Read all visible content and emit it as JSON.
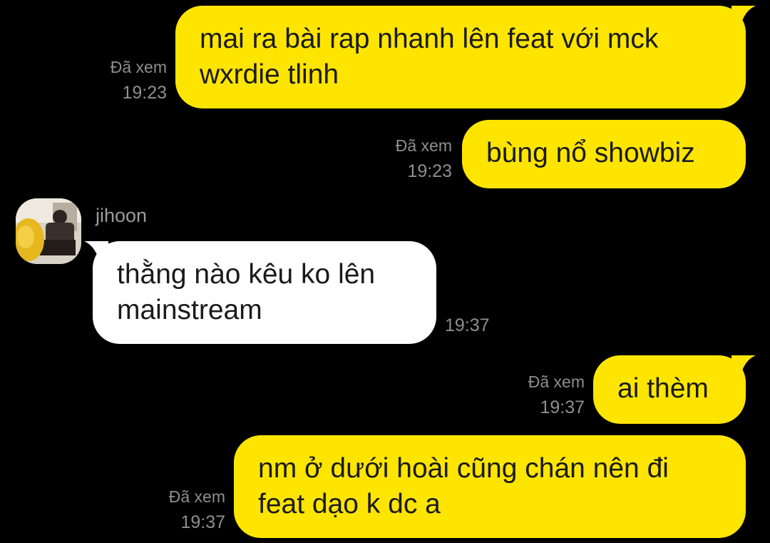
{
  "colors": {
    "background": "#000000",
    "my_bubble": "#fee500",
    "their_bubble": "#ffffff",
    "meta_text": "#8e8e8e"
  },
  "contact": {
    "name": "jihoon",
    "avatar_icon": "avatar-photo"
  },
  "messages": [
    {
      "sender": "me",
      "lines": [
        "mai ra bài rap nhanh lên feat với mck",
        "wxrdie tlinh"
      ],
      "seen": "Đã xem",
      "time": "19:23"
    },
    {
      "sender": "me",
      "lines": [
        "bùng nổ showbiz"
      ],
      "seen": "Đã xem",
      "time": "19:23"
    },
    {
      "sender": "jihoon",
      "lines": [
        "thằng nào kêu ko lên",
        "mainstream"
      ],
      "time": "19:37"
    },
    {
      "sender": "me",
      "lines": [
        "ai thèm"
      ],
      "seen": "Đã xem",
      "time": "19:37"
    },
    {
      "sender": "me",
      "lines": [
        "nm ở dưới hoài cũng chán nên đi",
        "feat dạo k dc a"
      ],
      "seen": "Đã xem",
      "time": "19:37"
    }
  ]
}
